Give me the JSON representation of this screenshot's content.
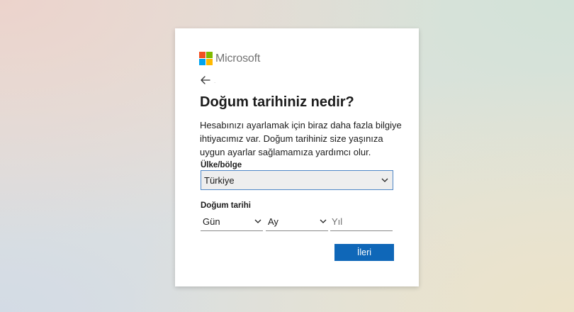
{
  "brand": {
    "name": "Microsoft",
    "logo_colors": [
      "#f25022",
      "#7fba00",
      "#00a4ef",
      "#ffb900"
    ],
    "logo_icon": "microsoft-logo-icon"
  },
  "navigation": {
    "back_icon": "arrow-left-icon"
  },
  "page": {
    "title": "Doğum tarihiniz nedir?",
    "description": "Hesabınızı ayarlamak için biraz daha fazla bilgiye ihtiyacımız var. Doğum tarihiniz size yaşınıza uygun ayarlar sağlamamıza yardımcı olur."
  },
  "form": {
    "country": {
      "label": "Ülke/bölge",
      "value": "Türkiye"
    },
    "birthdate": {
      "label": "Doğum tarihi",
      "day_placeholder": "Gün",
      "month_placeholder": "Ay",
      "year_placeholder": "Yıl"
    },
    "next_label": "İleri"
  },
  "colors": {
    "primary_button": "#0f67b8",
    "focus_border": "#4f86c6"
  }
}
